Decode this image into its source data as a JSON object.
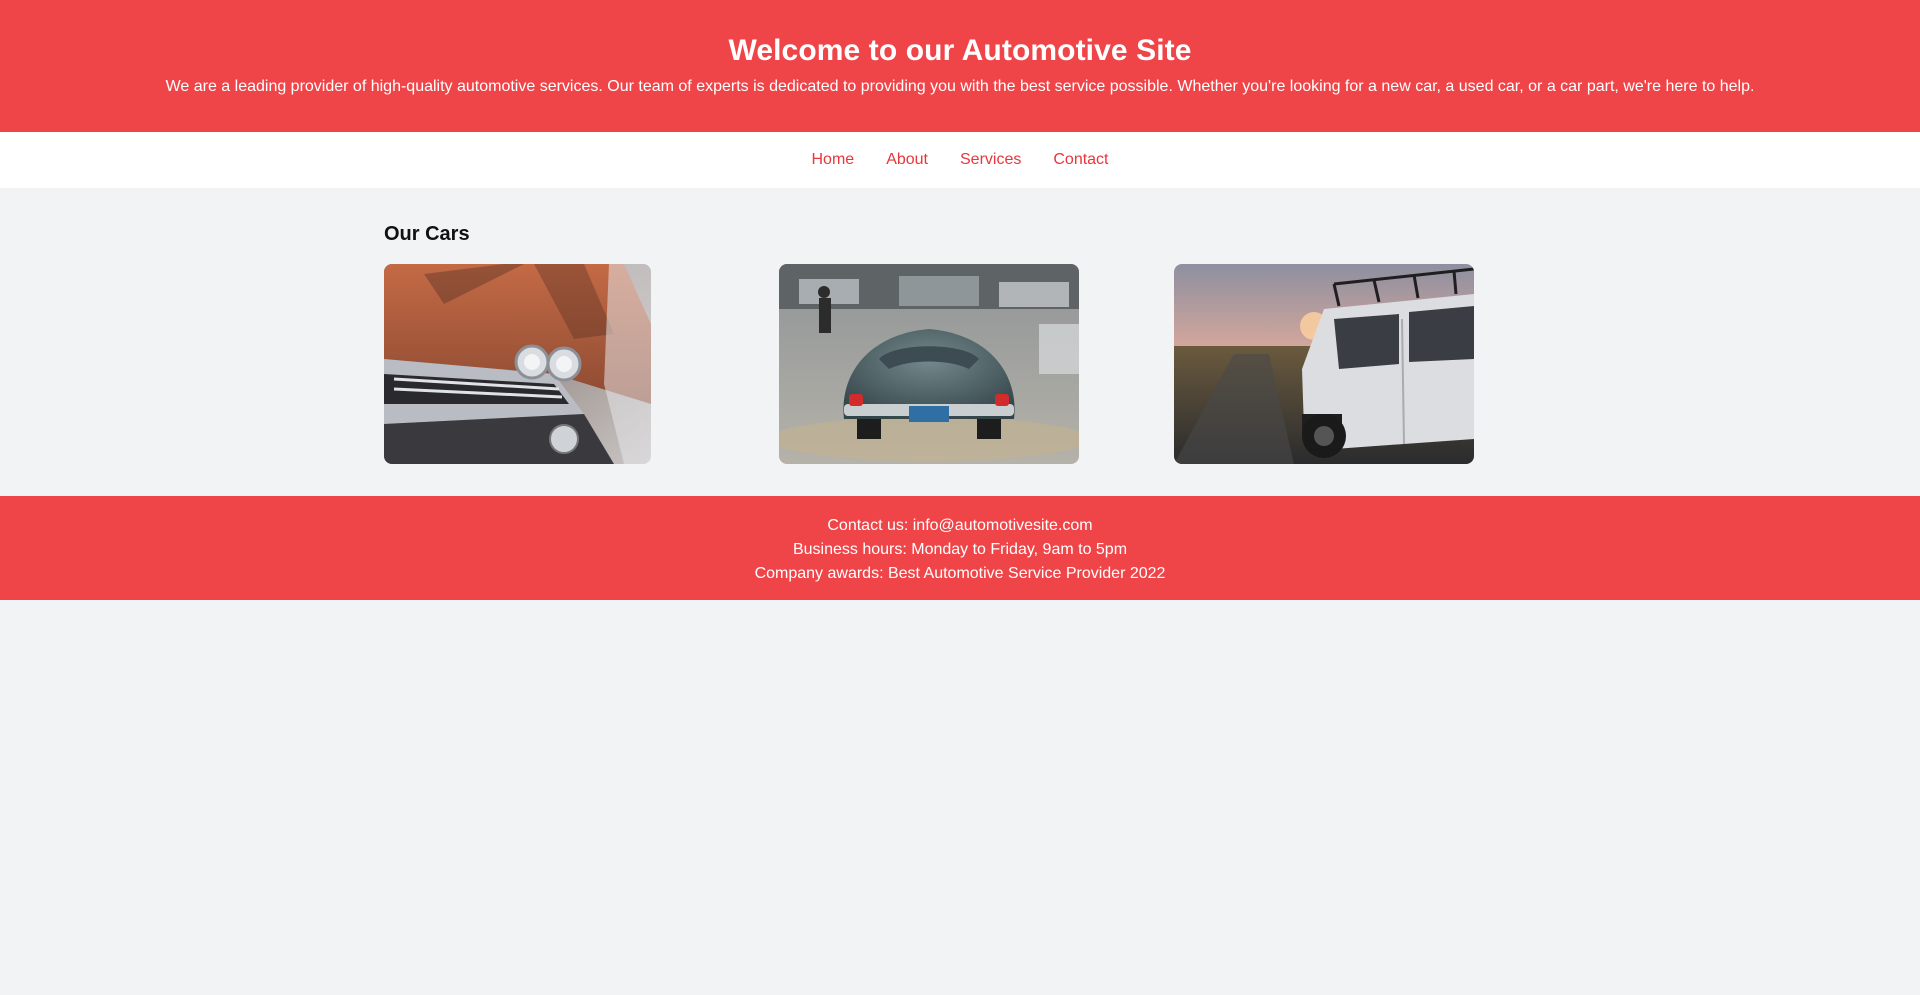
{
  "hero": {
    "title": "Welcome to our Automotive Site",
    "subtitle": "We are a leading provider of high-quality automotive services. Our team of experts is dedicated to providing you with the best service possible. Whether you're looking for a new car, a used car, or a car part, we're here to help."
  },
  "nav": {
    "items": [
      "Home",
      "About",
      "Services",
      "Contact"
    ]
  },
  "main": {
    "section_title": "Our Cars",
    "cars": [
      "vintage-orange-car-photo",
      "green-classic-coupe-photo",
      "white-offroad-suv-photo"
    ]
  },
  "footer": {
    "contact": "Contact us: info@automotivesite.com",
    "hours": "Business hours: Monday to Friday, 9am to 5pm",
    "awards": "Company awards: Best Automotive Service Provider 2022"
  },
  "colors": {
    "brand_red": "#f04548",
    "nav_link": "#e7373b",
    "page_bg": "#f2f3f5"
  }
}
